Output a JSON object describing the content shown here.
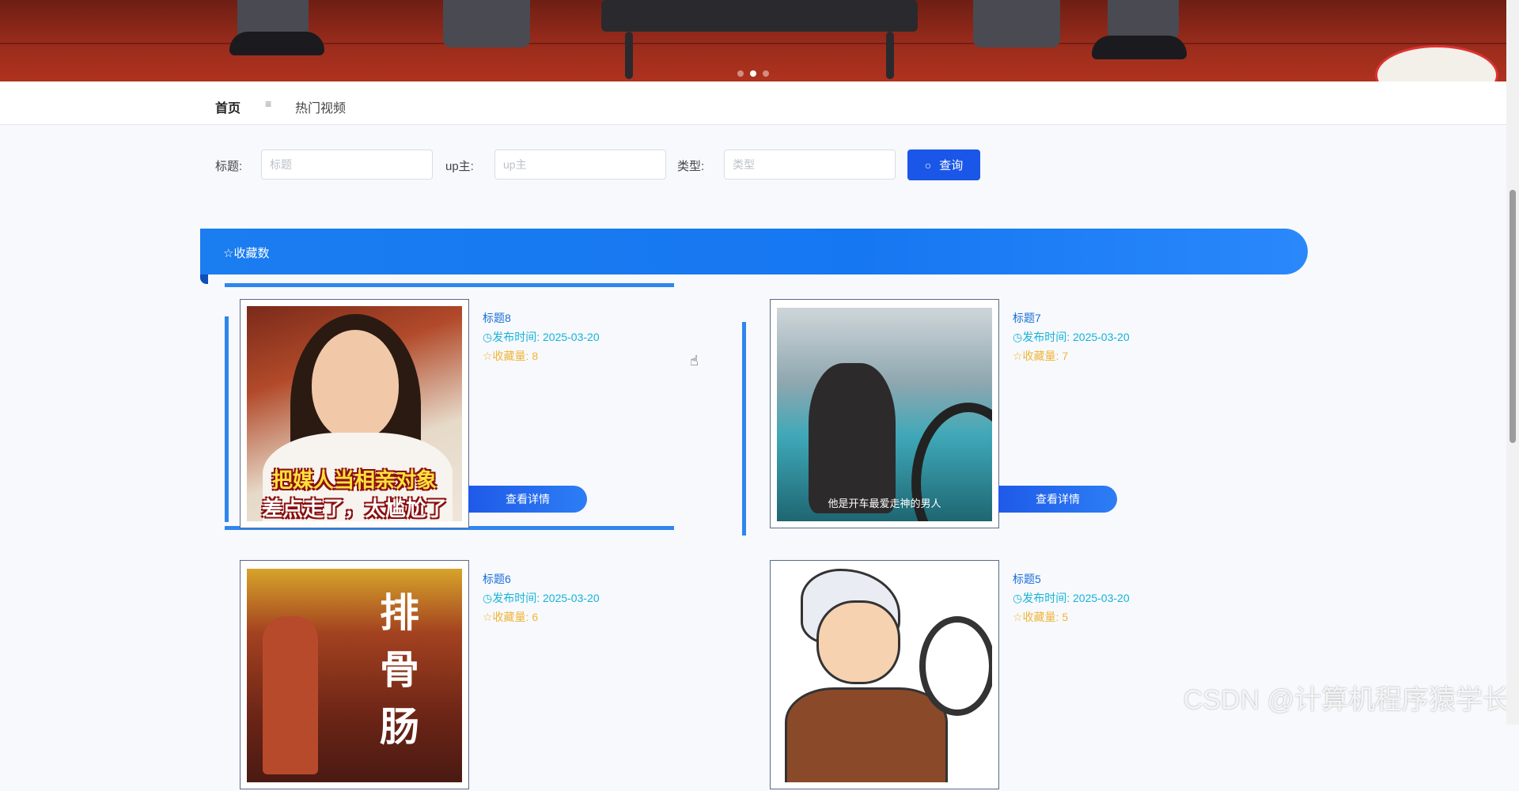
{
  "nav": {
    "home": "首页",
    "separator": "≡",
    "hot_videos": "热门视频"
  },
  "search": {
    "title_label": "标题:",
    "title_placeholder": "标题",
    "up_label": "up主:",
    "up_placeholder": "up主",
    "type_label": "类型:",
    "type_placeholder": "类型",
    "query_button": "查询",
    "query_icon": "search-icon"
  },
  "section": {
    "title": "☆收藏数",
    "icon": "star-icon"
  },
  "cards": [
    {
      "title": "标题8",
      "time": "◷发布时间: 2025-03-20",
      "fav": "☆收藏量: 8",
      "detail": "查看详情",
      "caption_1": "把媒人当相亲对象",
      "caption_2": "差点走了，太尴尬了"
    },
    {
      "title": "标题7",
      "time": "◷发布时间: 2025-03-20",
      "fav": "☆收藏量: 7",
      "detail": "查看详情",
      "caption": "他是开车最爱走神的男人"
    },
    {
      "title": "标题6",
      "time": "◷发布时间: 2025-03-20",
      "fav": "☆收藏量: 6",
      "caption": "排骨肠"
    },
    {
      "title": "标题5",
      "time": "◷发布时间: 2025-03-20",
      "fav": "☆收藏量: 5"
    }
  ],
  "watermark": "CSDN @计算机程序猿学长"
}
